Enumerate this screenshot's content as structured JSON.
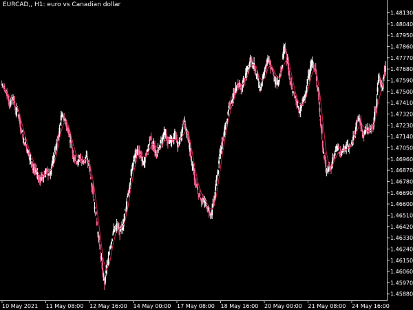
{
  "window": {
    "symbol_label": "EURCAD,, H1:  euro vs Canadian dollar"
  },
  "colors": {
    "background": "#000000",
    "axis": "#c8c8c8",
    "text": "#ffffff",
    "candle_bull": "#ffffff",
    "candle_bear": "#ff6699",
    "indicator_line": "#cc2244"
  },
  "chart_data": {
    "type": "candlestick",
    "symbol": "EURCAD",
    "timeframe": "H1",
    "title": "euro vs Canadian dollar",
    "y_ticks": [
      "1.48130",
      "1.48040",
      "1.47950",
      "1.47860",
      "1.47770",
      "1.47680",
      "1.47590",
      "1.47500",
      "1.47410",
      "1.47320",
      "1.47230",
      "1.47140",
      "1.47050",
      "1.46960",
      "1.46870",
      "1.46780",
      "1.46690",
      "1.46600",
      "1.46510",
      "1.46420",
      "1.46330",
      "1.46240",
      "1.46150",
      "1.46060",
      "1.45970",
      "1.45880"
    ],
    "y_tick_values": [
      1.4813,
      1.4804,
      1.4795,
      1.4786,
      1.4777,
      1.4768,
      1.4759,
      1.475,
      1.4741,
      1.4732,
      1.4723,
      1.4714,
      1.4705,
      1.4696,
      1.4687,
      1.4678,
      1.4669,
      1.466,
      1.4651,
      1.4642,
      1.4633,
      1.4624,
      1.4615,
      1.4606,
      1.4597,
      1.4588
    ],
    "x_ticks": [
      "10 May 2021",
      "11 May 08:00",
      "12 May 16:00",
      "14 May 00:00",
      "17 May 08:00",
      "18 May 16:00",
      "20 May 00:00",
      "21 May 08:00",
      "24 May 16:00"
    ],
    "ylim": [
      1.4584,
      1.4821
    ],
    "indicator": "moving average (red line)",
    "close_series": [
      1.4753,
      1.4748,
      1.4739,
      1.4745,
      1.4735,
      1.473,
      1.4716,
      1.4708,
      1.4702,
      1.4694,
      1.4688,
      1.4683,
      1.4679,
      1.4683,
      1.4688,
      1.4684,
      1.4692,
      1.4704,
      1.4716,
      1.473,
      1.4728,
      1.4721,
      1.4708,
      1.4698,
      1.4694,
      1.4696,
      1.4694,
      1.4698,
      1.469,
      1.4674,
      1.4654,
      1.4634,
      1.4614,
      1.4597,
      1.4611,
      1.4628,
      1.4638,
      1.4643,
      1.4638,
      1.4642,
      1.4656,
      1.4672,
      1.4688,
      1.4698,
      1.4703,
      1.4698,
      1.4693,
      1.4702,
      1.4714,
      1.4708,
      1.4699,
      1.4704,
      1.4712,
      1.4716,
      1.4708,
      1.4711,
      1.4716,
      1.4707,
      1.4711,
      1.4726,
      1.4718,
      1.4703,
      1.4688,
      1.4676,
      1.4668,
      1.4664,
      1.4661,
      1.4656,
      1.4651,
      1.4663,
      1.4684,
      1.4701,
      1.4714,
      1.4727,
      1.4741,
      1.4745,
      1.4751,
      1.4757,
      1.4753,
      1.4761,
      1.4768,
      1.4776,
      1.4771,
      1.4764,
      1.4751,
      1.4761,
      1.4771,
      1.4775,
      1.4768,
      1.4757,
      1.4758,
      1.4768,
      1.4785,
      1.4774,
      1.4757,
      1.4748,
      1.4741,
      1.4734,
      1.4742,
      1.4748,
      1.4762,
      1.4773,
      1.4768,
      1.4751,
      1.4723,
      1.4698,
      1.4686,
      1.4688,
      1.4697,
      1.4704,
      1.4702,
      1.4703,
      1.4704,
      1.4706,
      1.4707,
      1.4718,
      1.4728,
      1.4724,
      1.4716,
      1.4719,
      1.4718,
      1.4722,
      1.4738,
      1.4761,
      1.4752,
      1.4768
    ]
  }
}
